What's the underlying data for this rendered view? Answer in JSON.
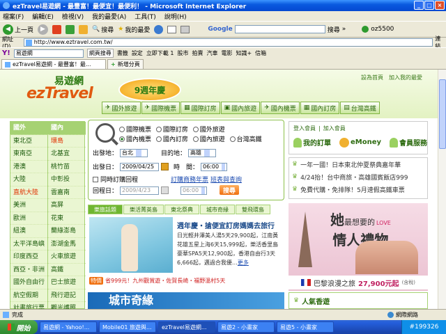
{
  "window": {
    "title": "ezTravel易遊網 - 最豐富！最便宜！最便利！ - Microsoft Internet Explorer"
  },
  "menu": [
    "檔案(F)",
    "編輯(E)",
    "檢視(V)",
    "我的最愛(A)",
    "工具(T)",
    "說明(H)"
  ],
  "toolbar": {
    "back": "上一頁",
    "search": "搜尋",
    "favorites": "我的最愛",
    "google_search": "搜尋",
    "more": "»",
    "user": "oz5500"
  },
  "address": {
    "label": "網址(D)",
    "url": "http://www.eztravel.com.tw/",
    "links": "連結"
  },
  "yahoobar": {
    "query": "易遊網",
    "search": "網頁搜尋",
    "items": [
      "書籤",
      "設定",
      "立即下載 1",
      "股市",
      "拍賣",
      "汽車",
      "電影",
      "知識+",
      "信箱"
    ]
  },
  "tabs": [
    {
      "label": "ezTravel易遊網 - 最豐富！最..."
    },
    {
      "label": "新增分頁"
    }
  ],
  "site": {
    "logo_cn": "易遊網",
    "logo_en": "ezTravel",
    "anniversary": "9週年慶",
    "toplinks": [
      "設為首頁",
      "加入我的最愛"
    ],
    "navtabs": [
      "國外旅遊",
      "國際機票",
      "國際訂房",
      "國內旅遊",
      "國內機票",
      "國內訂房",
      "台灣高鐵"
    ],
    "leftnav": {
      "col1": [
        "國外",
        "東北亞",
        "東南亞",
        "港澳",
        "大陸",
        "直航大陸",
        "美洲",
        "歐洲",
        "紐澳",
        "太平洋島嶼",
        "印度西亞",
        "西亞・非洲",
        "國外自由行",
        "航空假期",
        "計畫旅行票"
      ],
      "col2": [
        "國內",
        "環島",
        "北基宜",
        "桃竹苗",
        "中彰投",
        "雲嘉南",
        "高屏",
        "花東",
        "蘭綠澎島",
        "澎湖金馬",
        "火車旅遊",
        "高鐵",
        "巴士旅遊",
        "飛行遊記",
        "觀光護照"
      ]
    },
    "search": {
      "options_row1": [
        "國際機票",
        "國際訂房",
        "國外旅遊"
      ],
      "options_row2": [
        "國內機票",
        "國內訂房",
        "國內旅遊",
        "台灣高鐵"
      ],
      "from_label": "出發地：",
      "from_value": "台北",
      "to_label": "目的地：",
      "to_value": "高雄",
      "depart_label": "出發日：",
      "depart_value": "2009/04/25",
      "time_label": "時　間：",
      "depart_time": "06:00",
      "roundtrip_label": "同時訂購回程",
      "link1": "訂購商務年票",
      "link2": "班表與查詢",
      "return_label": "回程日：",
      "return_value": "2009/4/23",
      "return_time": "06:00",
      "button": "搜尋"
    },
    "dealtabs": [
      "樂旅話題",
      "樂活菁英島",
      "東北祭典",
      "城市奇緣",
      "雙飛環島"
    ],
    "deal": {
      "title": "週年慶・搶便宜訂房媽媽去旅行",
      "text": "日光輕井澤美人湯5天29,900起，江南黃花雄五星上海6天15,999起，樂活香里島豪華SPA5天12,900起，香港自由行3天6,666起，邁過合我優…",
      "more": "更多"
    },
    "promo": {
      "badge": "特價",
      "text": "省999元！九州觀賞遊・佐賀長崎・福野溫村5天"
    },
    "city_banner": "城市奇緣",
    "member": {
      "login": "登入會員",
      "join": "加入會員",
      "orders": "我的訂單",
      "emoney": "eMoney",
      "service": "會員服務"
    },
    "news": [
      "一年一國！日本東北仲夏祭典嘉年華",
      "4/24抬！台中商旅・高雄國賓飯店999",
      "免費代購・免排隊！5月速假高鐵車票"
    ],
    "gift": {
      "line1": "她",
      "line2": "最想要的",
      "line3": "情人禮物",
      "love": "LOVE",
      "place": "巴黎浪漫之旅",
      "price": "27,900元起",
      "tax": "(含稅)"
    },
    "popular": "人氣香遊"
  },
  "status": {
    "left": "完成",
    "zone": "網際網路"
  },
  "taskbar": {
    "start": "開始",
    "items": [
      "易遊網 - Yahoo!...",
      "Mobile01 旅遊與...",
      "ezTravel易遊網...",
      "易遊2 - 小畫家",
      "易遊5 - 小畫家"
    ],
    "active": 2,
    "tray": "#199326"
  },
  "colors": {
    "xp_blue": "#0a5ae0",
    "site_green": "#6fb631",
    "accent_orange": "#f07010"
  }
}
